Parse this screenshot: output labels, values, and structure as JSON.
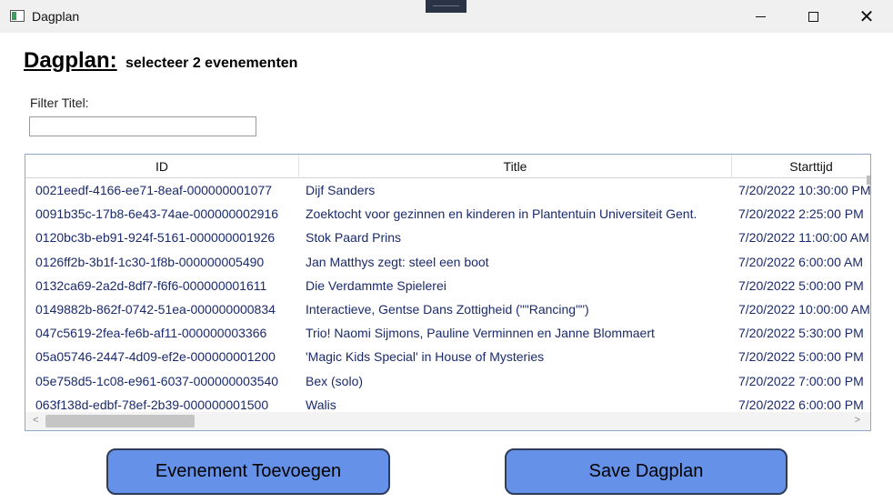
{
  "window": {
    "title": "Dagplan"
  },
  "icons": [
    "app-icon",
    "minimize-icon",
    "maximize-icon",
    "close-icon",
    "chevron-left-icon",
    "chevron-right-icon"
  ],
  "header": {
    "title": "Dagplan:",
    "subtitle": "selecteer 2 evenementen"
  },
  "filter": {
    "label": "Filter Titel:",
    "value": ""
  },
  "grid": {
    "columns": [
      "ID",
      "Title",
      "Starttijd"
    ],
    "rows": [
      {
        "id": "0021eedf-4166-ee71-8eaf-000000001077",
        "title": "Dijf Sanders",
        "start": "7/20/2022 10:30:00 PM"
      },
      {
        "id": "0091b35c-17b8-6e43-74ae-000000002916",
        "title": "Zoektocht voor gezinnen en kinderen in Plantentuin Universiteit Gent.",
        "start": "7/20/2022 2:25:00 PM"
      },
      {
        "id": "0120bc3b-eb91-924f-5161-000000001926",
        "title": "Stok Paard Prins",
        "start": "7/20/2022 11:00:00 AM"
      },
      {
        "id": "0126ff2b-3b1f-1c30-1f8b-000000005490",
        "title": "Jan Matthys zegt: steel een boot",
        "start": "7/20/2022 6:00:00 AM"
      },
      {
        "id": "0132ca69-2a2d-8df7-f6f6-000000001611",
        "title": "Die Verdammte Spielerei",
        "start": "7/20/2022 5:00:00 PM"
      },
      {
        "id": "0149882b-862f-0742-51ea-000000000834",
        "title": "Interactieve, Gentse Dans Zottigheid (\"\"Rancing\"\")",
        "start": "7/20/2022 10:00:00 AM"
      },
      {
        "id": "047c5619-2fea-fe6b-af11-000000003366",
        "title": "Trio! Naomi Sijmons, Pauline Verminnen en Janne Blommaert",
        "start": "7/20/2022 5:30:00 PM"
      },
      {
        "id": "05a05746-2447-4d09-ef2e-000000001200",
        "title": "'Magic Kids Special' in House of Mysteries",
        "start": "7/20/2022 5:00:00 PM"
      },
      {
        "id": "05e758d5-1c08-e961-6037-000000003540",
        "title": "Bex (solo)",
        "start": "7/20/2022 7:00:00 PM"
      },
      {
        "id": "063f138d-edbf-78ef-2b39-000000001500",
        "title": "Walis",
        "start": "7/20/2022 6:00:00 PM"
      }
    ]
  },
  "buttons": {
    "add_label": "Evenement Toevoegen",
    "save_label": "Save Dagplan"
  },
  "colors": {
    "button_fill": "#6592e8",
    "button_border": "#2e3c5a",
    "row_text": "#1a2a6c",
    "grid_border": "#8fa7c7"
  }
}
